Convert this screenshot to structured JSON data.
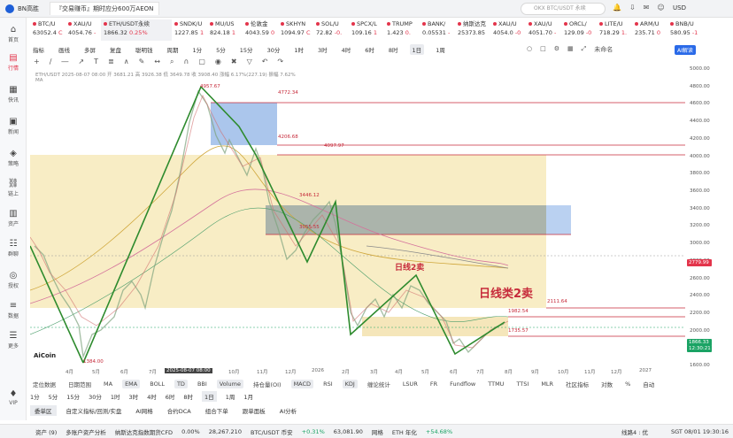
{
  "window": {
    "app": "BN高胜",
    "tab": "『交易赚币』期时应分600万AEON",
    "search_placeholder": "OKX BTC/USDT 永续",
    "currency": "USD"
  },
  "sidebar": [
    {
      "label": "首页",
      "icon": "home-icon"
    },
    {
      "label": "行情",
      "icon": "chart-icon"
    },
    {
      "label": "快讯",
      "icon": "news-icon"
    },
    {
      "label": "新闻",
      "icon": "doc-icon"
    },
    {
      "label": "策略",
      "icon": "strategy-icon"
    },
    {
      "label": "链上",
      "icon": "chain-icon"
    },
    {
      "label": "资产",
      "icon": "wallet-icon"
    },
    {
      "label": "群聊",
      "icon": "chat-icon"
    },
    {
      "label": "授权",
      "icon": "auth-icon"
    },
    {
      "label": "数据",
      "icon": "data-icon"
    },
    {
      "label": "更多",
      "icon": "more-icon"
    },
    {
      "label": "VIP",
      "icon": "vip-icon"
    }
  ],
  "tickers": [
    {
      "name": "BTC/U",
      "price": "63052.4",
      "chg": "C"
    },
    {
      "name": "XAU/U",
      "price": "4054.76",
      "chg": "-"
    },
    {
      "name": "ETH/USDT永续",
      "price": "1866.32",
      "chg": "0.25%"
    },
    {
      "name": "SNDK/U",
      "price": "1227.85",
      "chg": "1"
    },
    {
      "name": "MU/US",
      "price": "824.18",
      "chg": "1"
    },
    {
      "name": "伦敦金",
      "price": "4043.59",
      "chg": "0"
    },
    {
      "name": "SKHYN",
      "price": "1094.97",
      "chg": "C"
    },
    {
      "name": "SOL/U",
      "price": "72.82",
      "chg": "-0."
    },
    {
      "name": "SPCX/L",
      "price": "109.16",
      "chg": "1"
    },
    {
      "name": "TRUMP",
      "price": "1.423",
      "chg": "0."
    },
    {
      "name": "BANK/",
      "price": "0.05531",
      "chg": "-"
    },
    {
      "name": "纳斯达克",
      "price": "25373.85",
      "chg": ""
    },
    {
      "name": "XAU/U",
      "price": "4054.0",
      "chg": "-0"
    },
    {
      "name": "XAU/U",
      "price": "4051.70",
      "chg": "-"
    },
    {
      "name": "ORCL/",
      "price": "129.09",
      "chg": "-0"
    },
    {
      "name": "LITE/U",
      "price": "718.29",
      "chg": "1."
    },
    {
      "name": "ARM/U",
      "price": "235.71",
      "chg": "0"
    },
    {
      "name": "BNB/U",
      "price": "580.95",
      "chg": "-1"
    }
  ],
  "toolbar1": {
    "tabs": [
      "指标",
      "画线",
      "多屏",
      "复盘",
      "聪明钱",
      "周期",
      "1分",
      "5分",
      "15分",
      "30分",
      "1时",
      "3时",
      "4时",
      "6时",
      "8时",
      "1日",
      "1周"
    ],
    "right": [
      "未命名",
      "AI解读"
    ]
  },
  "legend": {
    "line1": "ETH/USDT 2025-08-07 08:00 开 3681.21 高 3926.38 低 3649.78 收 3908.40 涨幅 6.17%(227.19) 振幅 7.62%",
    "line2": "MA"
  },
  "y_axis": {
    "ticks": [
      "5000.00",
      "4800.00",
      "4600.00",
      "4400.00",
      "4200.00",
      "4000.00",
      "3800.00",
      "3600.00",
      "3400.00",
      "3200.00",
      "3000.00",
      "2800.00",
      "2600.00",
      "2400.00",
      "2200.00",
      "2000.00",
      "1800.00",
      "1600.00"
    ],
    "badges": [
      {
        "text": "2779.99",
        "color": "#e3344b"
      },
      {
        "text": "1866.33",
        "color": "#1aa364"
      },
      {
        "text": "12:30:21",
        "color": "#1aa364"
      }
    ]
  },
  "x_axis": [
    "4月",
    "5月",
    "6月",
    "7月",
    "2025-08-07 08:00",
    "10月",
    "11月",
    "12月",
    "2026",
    "2月",
    "3月",
    "4月",
    "5月",
    "6月",
    "7月",
    "8月",
    "9月",
    "10月",
    "11月",
    "12月",
    "2027"
  ],
  "annotations": {
    "price_levels": [
      "4957.67",
      "4772.34",
      "4206.68",
      "4097.97",
      "3446.12",
      "3055.55",
      "2111.64",
      "1982.54",
      "1735.57",
      "1384.00"
    ],
    "labels": [
      "日线2卖",
      "日线类2卖"
    ]
  },
  "watermark": "AiCoin",
  "indicators_row": [
    "定位数据",
    "日期范围",
    "MA",
    "EMA",
    "BOLL",
    "TD",
    "BBI",
    "Volume",
    "持仓量(OI)",
    "MACD",
    "RSI",
    "KDJ",
    "缠论统计",
    "LSUR",
    "FR",
    "Fundflow",
    "TTMU",
    "TTSI",
    "MLR",
    "社区指标",
    "对数",
    "%",
    "自动"
  ],
  "timeframes": [
    "1分",
    "5分",
    "15分",
    "30分",
    "1时",
    "3时",
    "4时",
    "6时",
    "8时",
    "1日",
    "1周",
    "1月"
  ],
  "functions": [
    "委单区",
    "自定义指标/回测/实盘",
    "AI网格",
    "合约DCA",
    "组合下单",
    "跟单面板",
    "AI分析"
  ],
  "status": {
    "left": "资产 (9)",
    "analysis": "多账户资产分析",
    "nasdaq": "纳斯达克指数期货CFD",
    "nasdaq_chg": "0.00%",
    "nasdaq_val": "28,267.210",
    "btc": "BTC/USDT 币安",
    "btc_chg": "+0.31%",
    "btc_val": "63,081.90",
    "eth_label": "网格",
    "eth": "ETH 年化",
    "eth_chg": "+54.68%",
    "line": "线路4 : 优",
    "time": "SGT 08/01 19:30:16"
  },
  "chart_data": {
    "type": "candlestick",
    "series": [
      {
        "name": "ETH/USDT",
        "x_range": [
          "2025-03",
          "2026-07"
        ],
        "y_range": [
          1384.0,
          4957.67
        ]
      }
    ],
    "ylim": [
      1550,
      5000
    ]
  }
}
